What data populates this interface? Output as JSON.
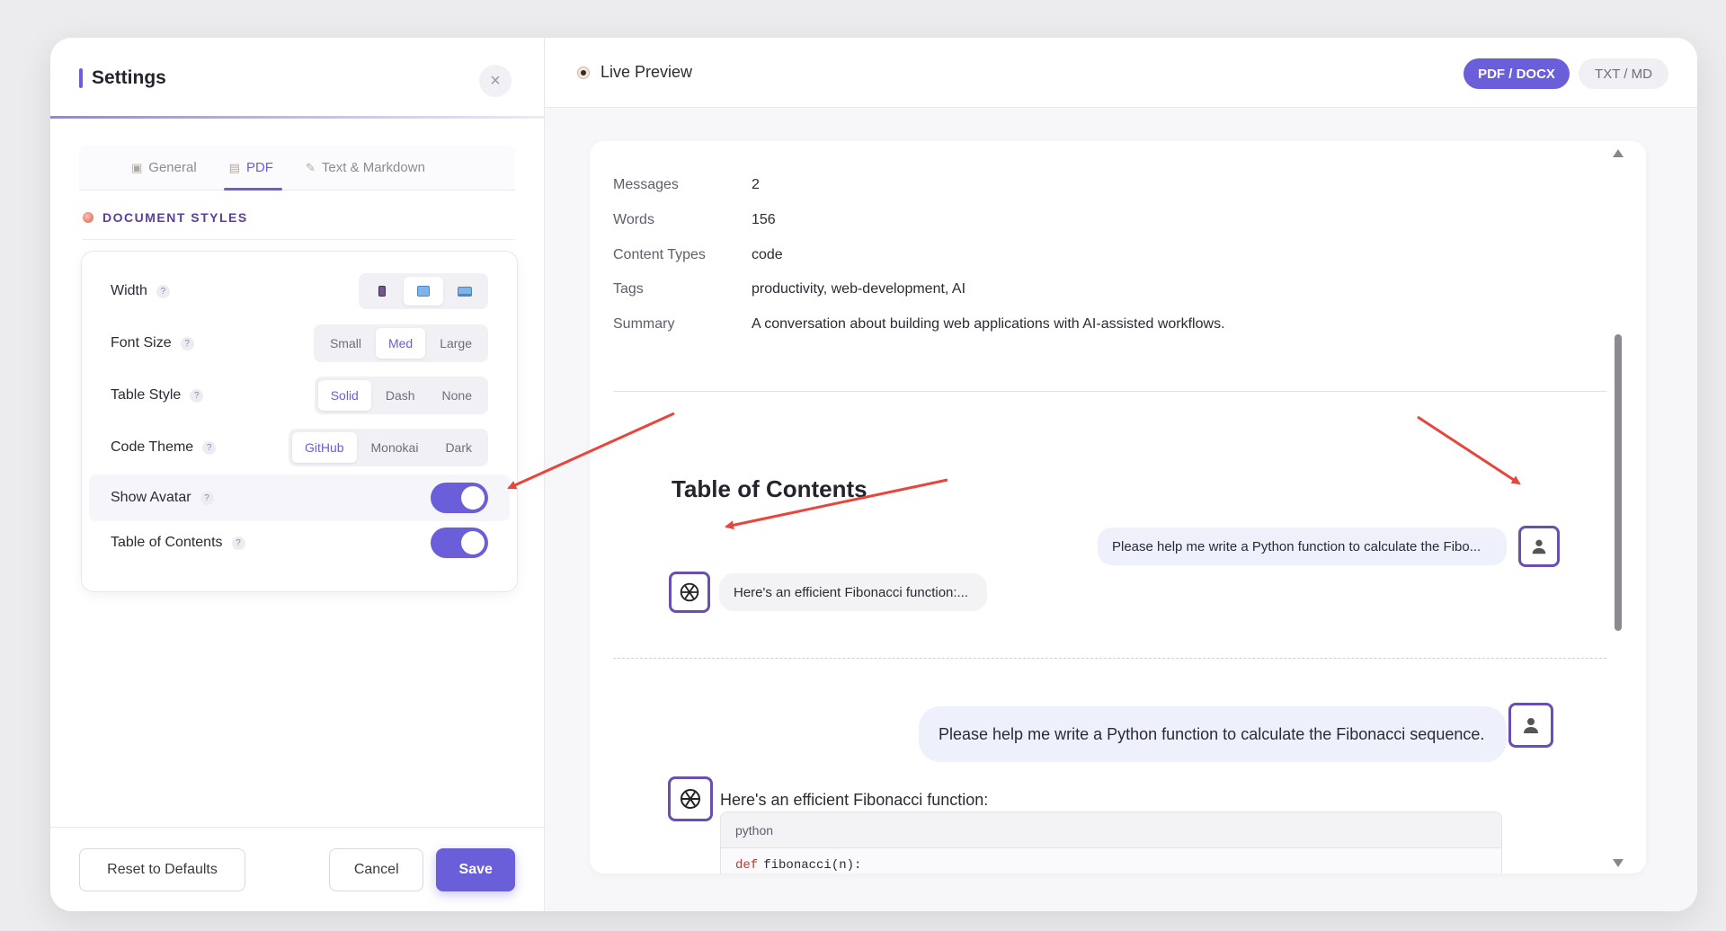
{
  "settings": {
    "title": "Settings",
    "close_icon": "×",
    "tabs": [
      {
        "label": "General",
        "icon": "clipboard-icon",
        "active": false
      },
      {
        "label": "PDF",
        "icon": "document-icon",
        "active": true
      },
      {
        "label": "Text & Markdown",
        "icon": "pencil-icon",
        "active": false
      }
    ],
    "section_label": "DOCUMENT STYLES",
    "rows": {
      "width": {
        "label": "Width",
        "options": [
          "mobile-icon",
          "tablet-icon",
          "desktop-icon"
        ],
        "selected": "tablet-icon"
      },
      "font_size": {
        "label": "Font Size",
        "options": [
          "Small",
          "Med",
          "Large"
        ],
        "selected": "Med"
      },
      "table_style": {
        "label": "Table Style",
        "options": [
          "Solid",
          "Dash",
          "None"
        ],
        "selected": "Solid"
      },
      "code_theme": {
        "label": "Code Theme",
        "options": [
          "GitHub",
          "Monokai",
          "Dark"
        ],
        "selected": "GitHub"
      },
      "show_avatar": {
        "label": "Show Avatar",
        "enabled": true
      },
      "toc": {
        "label": "Table of Contents",
        "enabled": true
      }
    },
    "help_glyph": "?",
    "buttons": {
      "reset": "Reset to Defaults",
      "cancel": "Cancel",
      "save": "Save"
    }
  },
  "preview": {
    "title": "Live Preview",
    "formats": {
      "pdf_docx": "PDF / DOCX",
      "txt_md": "TXT / MD",
      "active": "PDF / DOCX"
    },
    "meta": [
      {
        "key": "Messages",
        "value": "2"
      },
      {
        "key": "Words",
        "value": "156"
      },
      {
        "key": "Content Types",
        "value": "code"
      },
      {
        "key": "Tags",
        "value": "productivity, web-development, AI"
      },
      {
        "key": "Summary",
        "value": "A conversation about building web applications with AI-assisted workflows."
      }
    ],
    "toc_title": "Table of Contents",
    "toc_user_msg": "Please help me write a Python function to calculate the Fibo...",
    "toc_ai_msg": "Here's an efficient Fibonacci function:...",
    "user_msg": "Please help me write a Python function to calculate the Fibonacci sequence.",
    "ai_msg": "Here's an efficient Fibonacci function:",
    "code_lang": "python",
    "code_keyword": "def",
    "code_line": "fibonacci(n):"
  },
  "colors": {
    "accent": "#6a5fd8",
    "annotation_arrow": "#e8453c"
  }
}
